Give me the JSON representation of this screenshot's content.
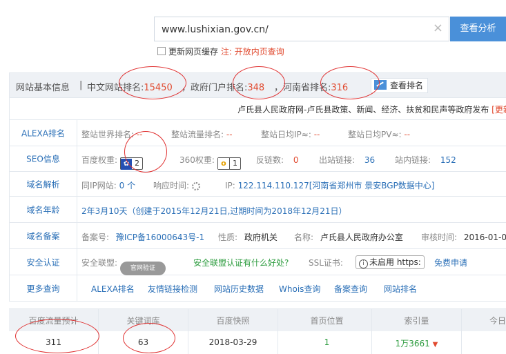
{
  "search": {
    "value": "www.lushixian.gov.cn/",
    "button": "查看分析",
    "clear_icon": "close-icon"
  },
  "cache": {
    "label": "更新网页缓存",
    "note": "注:",
    "link": "开放内页查询"
  },
  "header": {
    "title": "网站基本信息",
    "sep": "|",
    "cn_rank_label": "中文网站排名:",
    "cn_rank": "15450",
    "gov_rank_label": "，政府门户排名:",
    "gov_rank": "348",
    "prov_rank_label": "，河南省排名:",
    "prov_rank": "316",
    "rank_button": "查看排名"
  },
  "description": {
    "text": "卢氏县人民政府网-卢氏县政策、新闻、经济、扶贫和民声等政府发布",
    "more": "[更新"
  },
  "alexa": {
    "label": "ALEXA排名",
    "world_label": "整站世界排名:",
    "world": "--",
    "traffic_label": "整站流量排名:",
    "traffic": "--",
    "ip_label": "整站日均IP≈:",
    "ip": "--",
    "pv_label": "整站日均PV≈:",
    "pv": "--"
  },
  "seo": {
    "label": "SEO信息",
    "baidu_label": "百度权重:",
    "baidu": "2",
    "q360_label": "360权重:",
    "q360": "1",
    "backlinks_label": "反链数:",
    "backlinks": "0",
    "outlinks_label": "出站链接:",
    "outlinks": "36",
    "inlinks_label": "站内链接:",
    "inlinks": "152"
  },
  "dns": {
    "label": "域名解析",
    "same_ip_label": "同IP网站:",
    "same_ip": "0 个",
    "response_label": "响应时间:",
    "ip_label": "IP:",
    "ip": "122.114.110.127[河南省郑州市 景安BGP数据中心]"
  },
  "age": {
    "label": "域名年龄",
    "text": "2年3月10天（创建于2015年12月21日,过期时间为2018年12月21日）"
  },
  "icp": {
    "label": "域名备案",
    "no_label": "备案号:",
    "no": "豫ICP备16000643号-1",
    "nature_label": "性质:",
    "nature": "政府机关",
    "name_label": "名称:",
    "name": "卢氏县人民政府办公室",
    "time_label": "审核时间:",
    "time": "2016-01-0"
  },
  "security": {
    "label": "安全认证",
    "alliance_label": "安全联盟:",
    "seal_text": "官网验证",
    "alliance_link": "安全联盟认证有什么好处?",
    "ssl_label": "SSL证书:",
    "https_btn": "未启用 https:",
    "apply": "免费申请"
  },
  "more": {
    "label": "更多查询",
    "links": [
      "ALEXA排名",
      "友情链接检测",
      "网站历史数据",
      "Whois查询",
      "备案查询",
      "网站排名"
    ]
  },
  "bottom": {
    "columns": [
      {
        "h": "百度流量预计",
        "v": "311"
      },
      {
        "h": "关键词库",
        "v": "63"
      },
      {
        "h": "百度快照",
        "v": "2018-03-29"
      },
      {
        "h": "首页位置",
        "v": "1"
      },
      {
        "h": "索引量",
        "v": "1万3661"
      },
      {
        "h": "今日",
        "v": ""
      }
    ]
  }
}
